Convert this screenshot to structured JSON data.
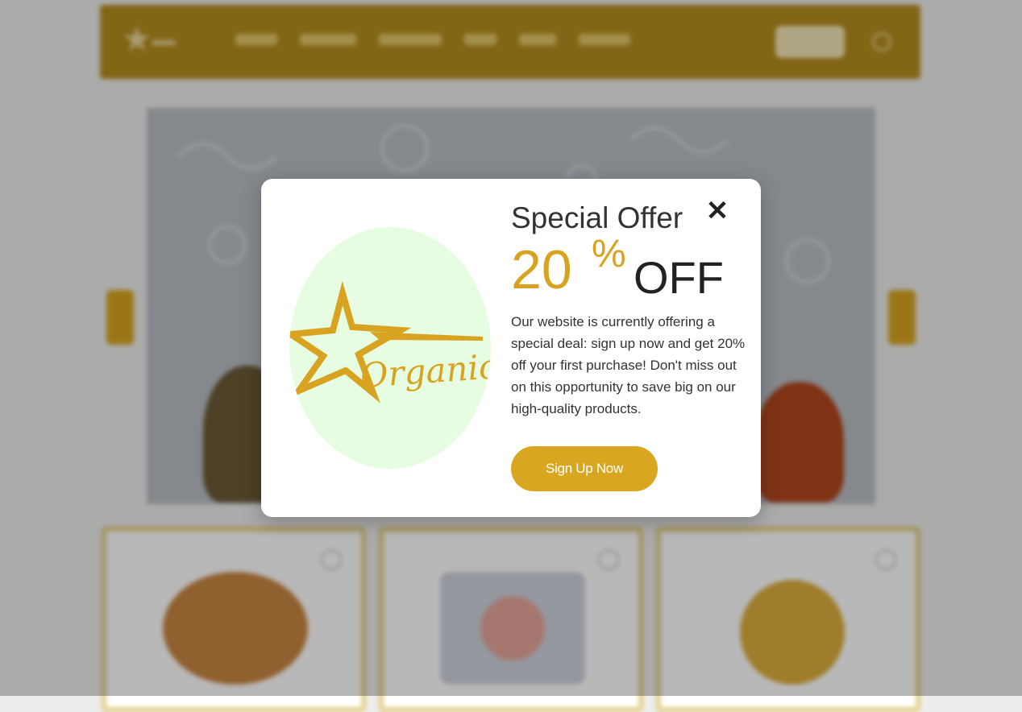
{
  "modal": {
    "brand_text": "Organic",
    "title": "Special Offer",
    "discount_value": "20",
    "discount_symbol": "%",
    "discount_word": "OFF",
    "description": "Our website is currently offering a special deal: sign up now and get 20% off your first purchase! Don't miss out on this opportunity to save big on our high-quality products.",
    "cta_label": "Sign Up Now",
    "close_symbol": "✕"
  },
  "colors": {
    "accent": "#d9a620",
    "logo_background": "#e6fde2",
    "header_background": "#b58d1e",
    "overlay": "rgba(0,0,0,0.28)"
  },
  "icons": {
    "close": "close-icon",
    "logo": "star-logo-icon",
    "favorite": "heart-icon"
  }
}
